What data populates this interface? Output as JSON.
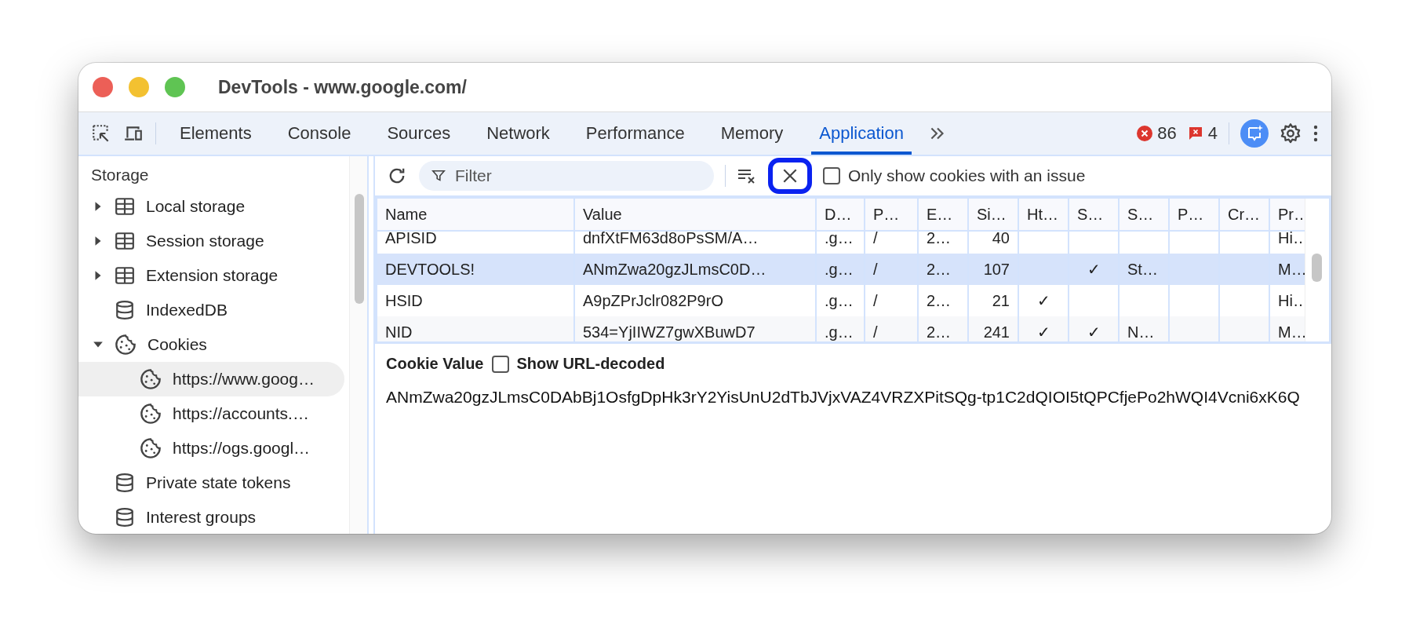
{
  "window": {
    "title": "DevTools - www.google.com/"
  },
  "tabs": [
    {
      "label": "Elements",
      "selected": false
    },
    {
      "label": "Console",
      "selected": false
    },
    {
      "label": "Sources",
      "selected": false
    },
    {
      "label": "Network",
      "selected": false
    },
    {
      "label": "Performance",
      "selected": false
    },
    {
      "label": "Memory",
      "selected": false
    },
    {
      "label": "Application",
      "selected": true
    }
  ],
  "error_count": "86",
  "issue_count": "4",
  "sidebar": {
    "heading": "Storage",
    "items": [
      {
        "label": "Local storage",
        "kind": "table",
        "expanded": false,
        "selected": false
      },
      {
        "label": "Session storage",
        "kind": "table",
        "expanded": false,
        "selected": false
      },
      {
        "label": "Extension storage",
        "kind": "table",
        "expanded": false,
        "selected": false
      },
      {
        "label": "IndexedDB",
        "kind": "database",
        "selected": false
      },
      {
        "label": "Cookies",
        "kind": "cookie",
        "expanded": true,
        "selected": false,
        "children": [
          {
            "label": "https://www.goog…",
            "kind": "cookie",
            "selected": true
          },
          {
            "label": "https://accounts.…",
            "kind": "cookie",
            "selected": false
          },
          {
            "label": "https://ogs.googl…",
            "kind": "cookie",
            "selected": false
          }
        ]
      },
      {
        "label": "Private state tokens",
        "kind": "database",
        "selected": false
      },
      {
        "label": "Interest groups",
        "kind": "database",
        "selected": false
      }
    ]
  },
  "filter": {
    "placeholder": "Filter"
  },
  "only_issues": {
    "label": "Only show cookies with an issue",
    "checked": false
  },
  "table": {
    "columns": [
      {
        "label": "Name",
        "kind": "text"
      },
      {
        "label": "Value",
        "kind": "text"
      },
      {
        "label": "D…",
        "kind": "text"
      },
      {
        "label": "P…",
        "kind": "text"
      },
      {
        "label": "E…",
        "kind": "text"
      },
      {
        "label": "Si…",
        "kind": "number"
      },
      {
        "label": "Ht…",
        "kind": "check"
      },
      {
        "label": "S…",
        "kind": "check"
      },
      {
        "label": "S…",
        "kind": "text"
      },
      {
        "label": "P…",
        "kind": "text"
      },
      {
        "label": "Cr…",
        "kind": "text"
      },
      {
        "label": "Pr…",
        "kind": "text"
      }
    ],
    "rows": [
      {
        "selected": false,
        "cells": [
          "APISID",
          "dnfXtFM63d8oPsSM/A…",
          ".g…",
          "/",
          "2…",
          "40",
          null,
          null,
          null,
          null,
          null,
          "Hi…"
        ]
      },
      {
        "selected": true,
        "cells": [
          "DEVTOOLS!",
          "ANmZwa20gzJLmsC0D…",
          ".g…",
          "/",
          "2…",
          "107",
          null,
          "✓",
          "St…",
          null,
          null,
          "M…"
        ]
      },
      {
        "selected": false,
        "cells": [
          "HSID",
          "A9pZPrJclr082P9rO",
          ".g…",
          "/",
          "2…",
          "21",
          "✓",
          null,
          null,
          null,
          null,
          "Hi…"
        ]
      },
      {
        "selected": false,
        "cells": [
          "NID",
          "534=YjIIWZ7gwXBuwD7",
          ".g…",
          "/",
          "2…",
          "241",
          "✓",
          "✓",
          "N…",
          null,
          null,
          "M…"
        ]
      }
    ]
  },
  "cookie_value": {
    "label": "Cookie Value",
    "decode": {
      "label": "Show URL-decoded",
      "checked": false
    },
    "value": "ANmZwa20gzJLmsC0DAbBj1OsfgDpHk3rY2YisUnU2dTbJVjxVAZ4VRZXPitSQg-tp1C2dQIOI5tQPCfjePo2hWQI4Vcni6xK6Q"
  }
}
